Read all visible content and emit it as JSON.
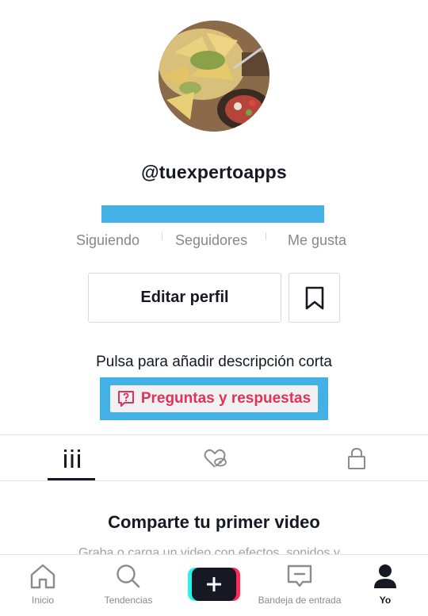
{
  "profile": {
    "username": "@tuexpertoapps",
    "stats": {
      "following_label": "Siguiendo",
      "followers_label": "Seguidores",
      "likes_label": "Me gusta"
    },
    "edit_profile_label": "Editar perfil",
    "bio_placeholder": "Pulsa para añadir descripción corta",
    "qa_label": "Preguntas y respuestas"
  },
  "tabs": [
    {
      "icon": "grid-icon",
      "active": true
    },
    {
      "icon": "liked-hidden-icon",
      "active": false
    },
    {
      "icon": "lock-icon",
      "active": false
    }
  ],
  "empty_state": {
    "title": "Comparte tu primer video",
    "subtitle": "Graba o carga un video con efectos, sonidos y..."
  },
  "bottom_nav": {
    "items": [
      {
        "label": "Inicio",
        "icon": "home-icon"
      },
      {
        "label": "Tendencias",
        "icon": "search-icon"
      },
      {
        "label": "",
        "icon": "plus-icon"
      },
      {
        "label": "Bandeja de entrada",
        "icon": "inbox-icon"
      },
      {
        "label": "Yo",
        "icon": "profile-icon"
      }
    ]
  },
  "colors": {
    "highlight": "#44b1e6",
    "qa_text": "#e0325a",
    "plus_cyan": "#25f4ee",
    "plus_red": "#fe2c55"
  }
}
